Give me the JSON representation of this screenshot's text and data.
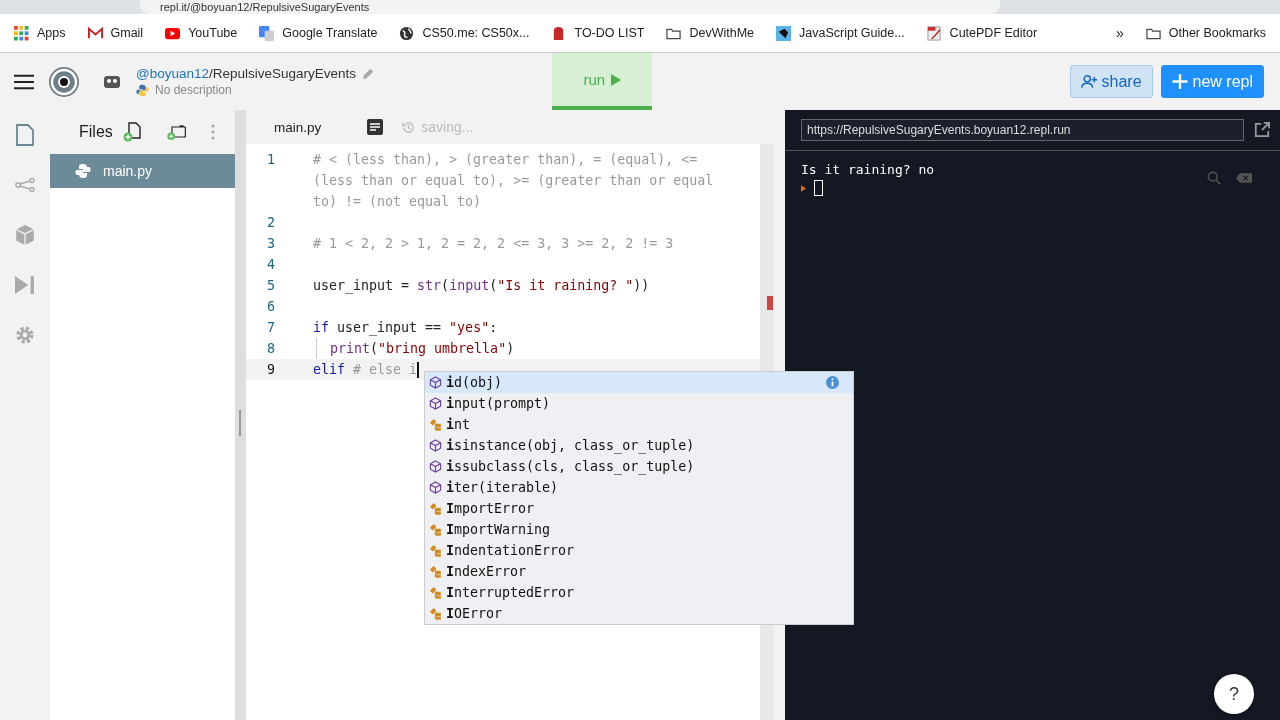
{
  "browser": {
    "address": "repl.it/@boyuan12/RepulsiveSugaryEvents"
  },
  "bookmarks": [
    {
      "label": "Apps",
      "kind": "grid"
    },
    {
      "label": "Gmail",
      "kind": "mail"
    },
    {
      "label": "YouTube",
      "kind": "video"
    },
    {
      "label": "Google Translate",
      "kind": "translate"
    },
    {
      "label": "CS50.me: CS50x...",
      "kind": "globe"
    },
    {
      "label": "TO-DO LIST",
      "kind": "bag"
    },
    {
      "label": "DevWithMe",
      "kind": "folder"
    },
    {
      "label": "JavaScript Guide...",
      "kind": "site"
    },
    {
      "label": "CutePDF Editor",
      "kind": "pdf"
    }
  ],
  "bookmarks_more": "»",
  "other_bookmarks": "Other Bookmarks",
  "header": {
    "owner": "@boyuan12",
    "separator": "/",
    "repl_name": "RepulsiveSugaryEvents",
    "description": "No description",
    "run_label": "run",
    "share_label": "share",
    "new_repl_label": "new repl"
  },
  "files": {
    "title": "Files",
    "items": [
      {
        "name": "main.py",
        "selected": true
      }
    ]
  },
  "editor": {
    "tab": "main.py",
    "status": "saving...",
    "lines": [
      {
        "number": "1",
        "tokens": [
          {
            "kind": "comment",
            "text": "# < (less than), > (greater than), = (equal), <= (less than or equal to), >= (greater than or equal to) != (not equal to)"
          }
        ]
      },
      {
        "number": "2"
      },
      {
        "number": "3",
        "tokens": [
          {
            "kind": "comment",
            "text": "# 1 < 2, 2 > 1, 2 = 2, 2 <= 3, 3 >= 2, 2 != 3"
          }
        ]
      },
      {
        "number": "4"
      },
      {
        "number": "5",
        "tokens": [
          {
            "kind": "plain",
            "text": "user_input = "
          },
          {
            "kind": "builtin",
            "text": "str"
          },
          {
            "kind": "plain",
            "text": "("
          },
          {
            "kind": "builtin",
            "text": "input"
          },
          {
            "kind": "plain",
            "text": "("
          },
          {
            "kind": "string",
            "text": "\"Is it raining? \""
          },
          {
            "kind": "plain",
            "text": "))"
          }
        ]
      },
      {
        "number": "6"
      },
      {
        "number": "7",
        "tokens": [
          {
            "kind": "keyword",
            "text": "if"
          },
          {
            "kind": "plain",
            "text": " user_input == "
          },
          {
            "kind": "string",
            "text": "\"yes\""
          },
          {
            "kind": "plain",
            "text": ":"
          }
        ]
      },
      {
        "number": "8",
        "indent": true,
        "tokens": [
          {
            "kind": "builtin",
            "text": "print"
          },
          {
            "kind": "plain",
            "text": "("
          },
          {
            "kind": "string",
            "text": "\"bring umbrella\""
          },
          {
            "kind": "plain",
            "text": ")"
          }
        ]
      },
      {
        "number": "9",
        "current": true,
        "tokens": [
          {
            "kind": "keyword",
            "text": "elif"
          },
          {
            "kind": "comment",
            "text": "# else i",
            "gap": true
          }
        ]
      }
    ]
  },
  "autocomplete": [
    {
      "kind": "function",
      "label": "**i**d(obj)",
      "selected": true
    },
    {
      "kind": "function",
      "label": "**i**nput(prompt)",
      "selected": false
    },
    {
      "kind": "class",
      "label": "**i**nt",
      "selected": false
    },
    {
      "kind": "function",
      "label": "**i**sinstance(obj, class_or_tuple)",
      "selected": false
    },
    {
      "kind": "function",
      "label": "**i**ssubclass(cls, class_or_tuple)",
      "selected": false
    },
    {
      "kind": "function",
      "label": "**i**ter(iterable)",
      "selected": false
    },
    {
      "kind": "class",
      "label": "**I**mportError",
      "selected": false
    },
    {
      "kind": "class",
      "label": "**I**mportWarning",
      "selected": false
    },
    {
      "kind": "class",
      "label": "**I**ndentationError",
      "selected": false
    },
    {
      "kind": "class",
      "label": "**I**ndexError",
      "selected": false
    },
    {
      "kind": "class",
      "label": "**I**nterruptedError",
      "selected": false
    },
    {
      "kind": "class",
      "label": "**I**OError",
      "selected": false
    }
  ],
  "console": {
    "url": "https://RepulsiveSugaryEvents.boyuan12.repl.run",
    "output": [
      "Is it raining? no"
    ]
  },
  "help_label": "?"
}
